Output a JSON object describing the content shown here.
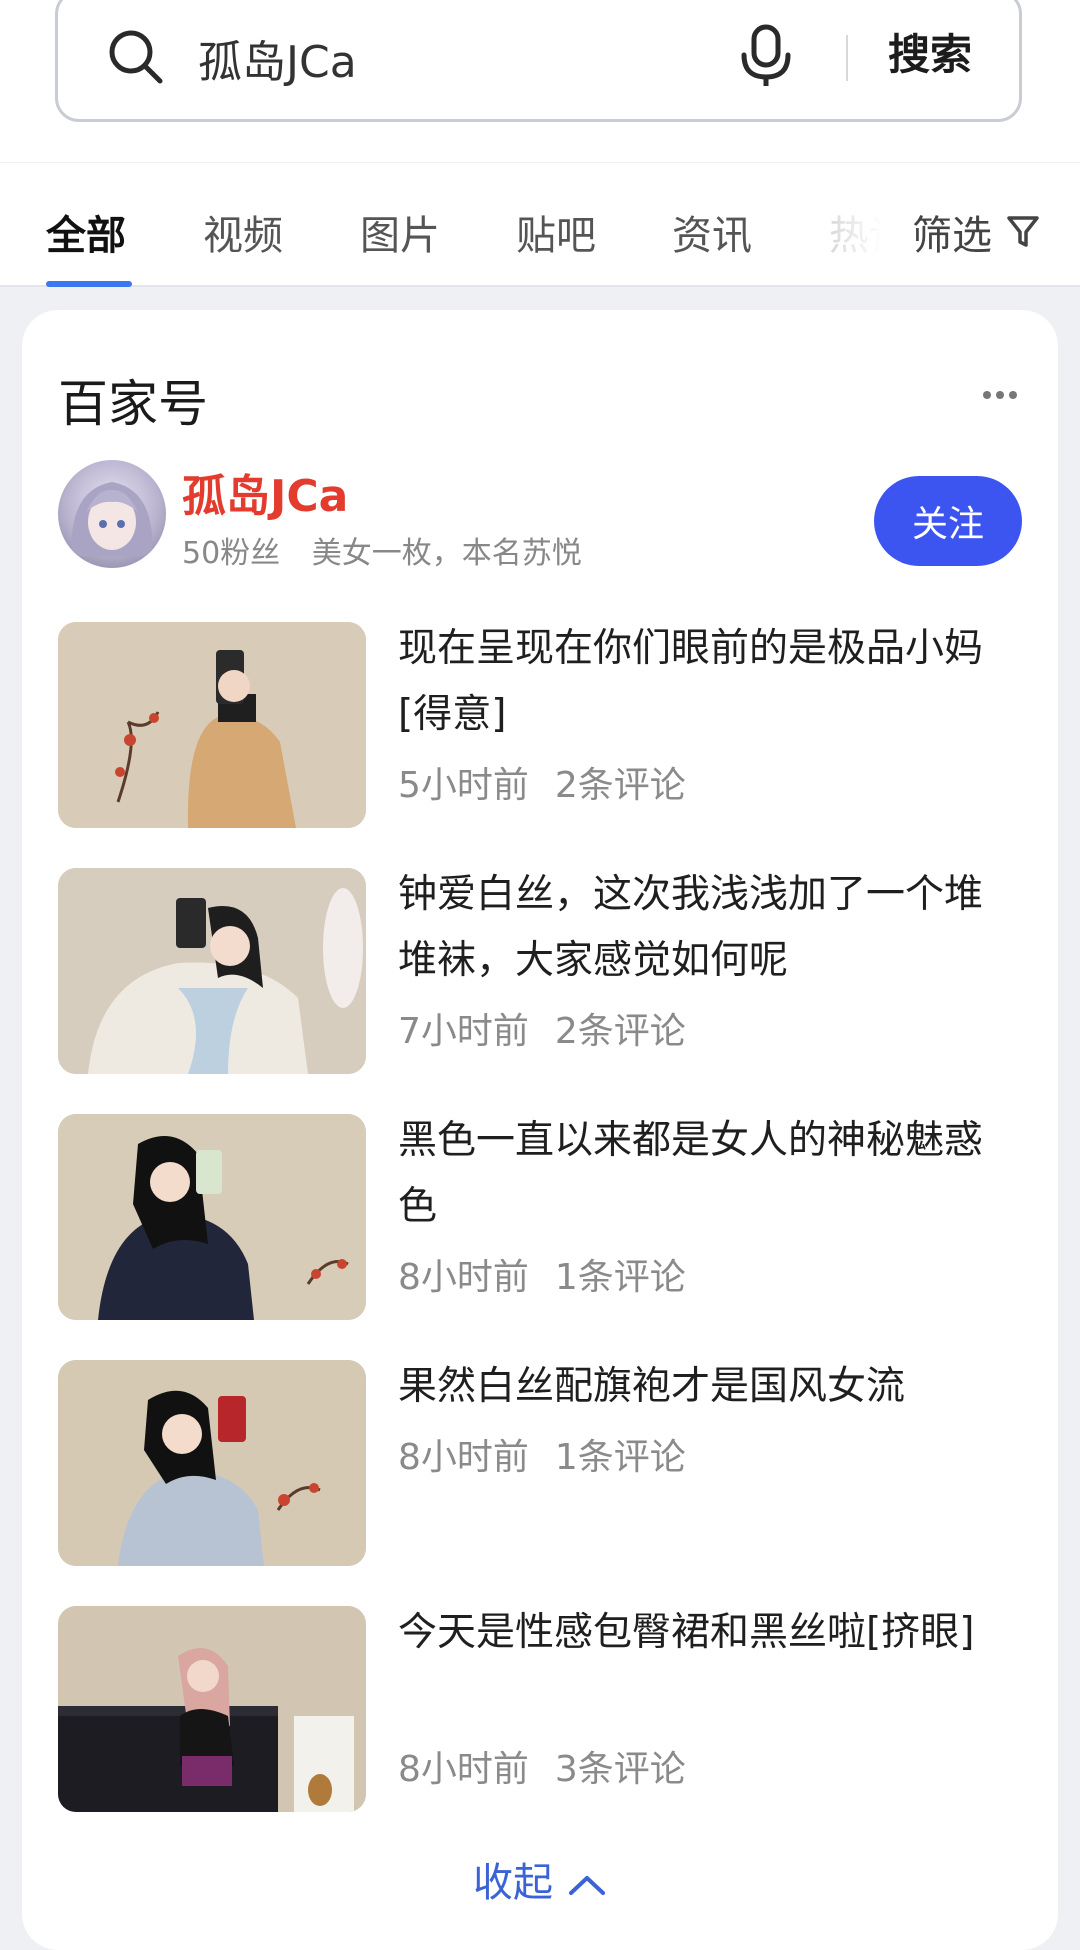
{
  "search": {
    "value": "孤岛JCa",
    "button_label": "搜索"
  },
  "tabs": [
    {
      "label": "全部",
      "active": true
    },
    {
      "label": "视频"
    },
    {
      "label": "图片"
    },
    {
      "label": "贴吧"
    },
    {
      "label": "资讯"
    },
    {
      "label": "热议"
    }
  ],
  "filter_label": "筛选",
  "card": {
    "title": "百家号",
    "author": {
      "name": "孤岛JCa",
      "fans": "50粉丝",
      "bio": "美女一枚，本名苏悦"
    },
    "follow_label": "关注",
    "items": [
      {
        "title": "现在呈现在你们眼前的是极品小妈[得意]",
        "time": "5小时前",
        "comments": "2条评论"
      },
      {
        "title": "钟爱白丝，这次我浅浅加了一个堆堆袜，大家感觉如何呢",
        "time": "7小时前",
        "comments": "2条评论"
      },
      {
        "title": "黑色一直以来都是女人的神秘魅惑色",
        "time": "8小时前",
        "comments": "1条评论"
      },
      {
        "title": "果然白丝配旗袍才是国风女流",
        "time": "8小时前",
        "comments": "1条评论"
      },
      {
        "title": "今天是性感包臀裙和黑丝啦[挤眼]",
        "time": "8小时前",
        "comments": "3条评论"
      }
    ],
    "collapse_label": "收起"
  },
  "colors": {
    "accent": "#3d55f0",
    "author_name": "#e33b2e",
    "link": "#3b63d6",
    "tab_underline": "#3b78f0"
  },
  "icons": [
    "search-icon",
    "mic-icon",
    "filter-icon",
    "more-icon",
    "chevron-up-icon"
  ]
}
